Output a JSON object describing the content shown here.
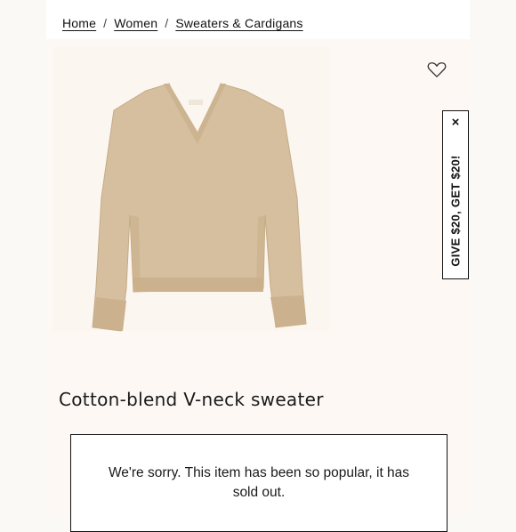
{
  "breadcrumb": {
    "items": [
      "Home",
      "Women",
      "Sweaters & Cardigans"
    ],
    "separator": "/"
  },
  "product": {
    "title": "Cotton-blend V-neck sweater",
    "image_icon": "sweater-image",
    "wishlist_icon": "heart-icon"
  },
  "promo": {
    "label": "GIVE $20, GET $20!",
    "close_label": "×"
  },
  "soldout": {
    "message": "We're sorry. This item has been so popular, it has sold out."
  },
  "colors": {
    "background": "#fdf8f4",
    "sweater": "#d6bf9f",
    "border": "#111111"
  }
}
